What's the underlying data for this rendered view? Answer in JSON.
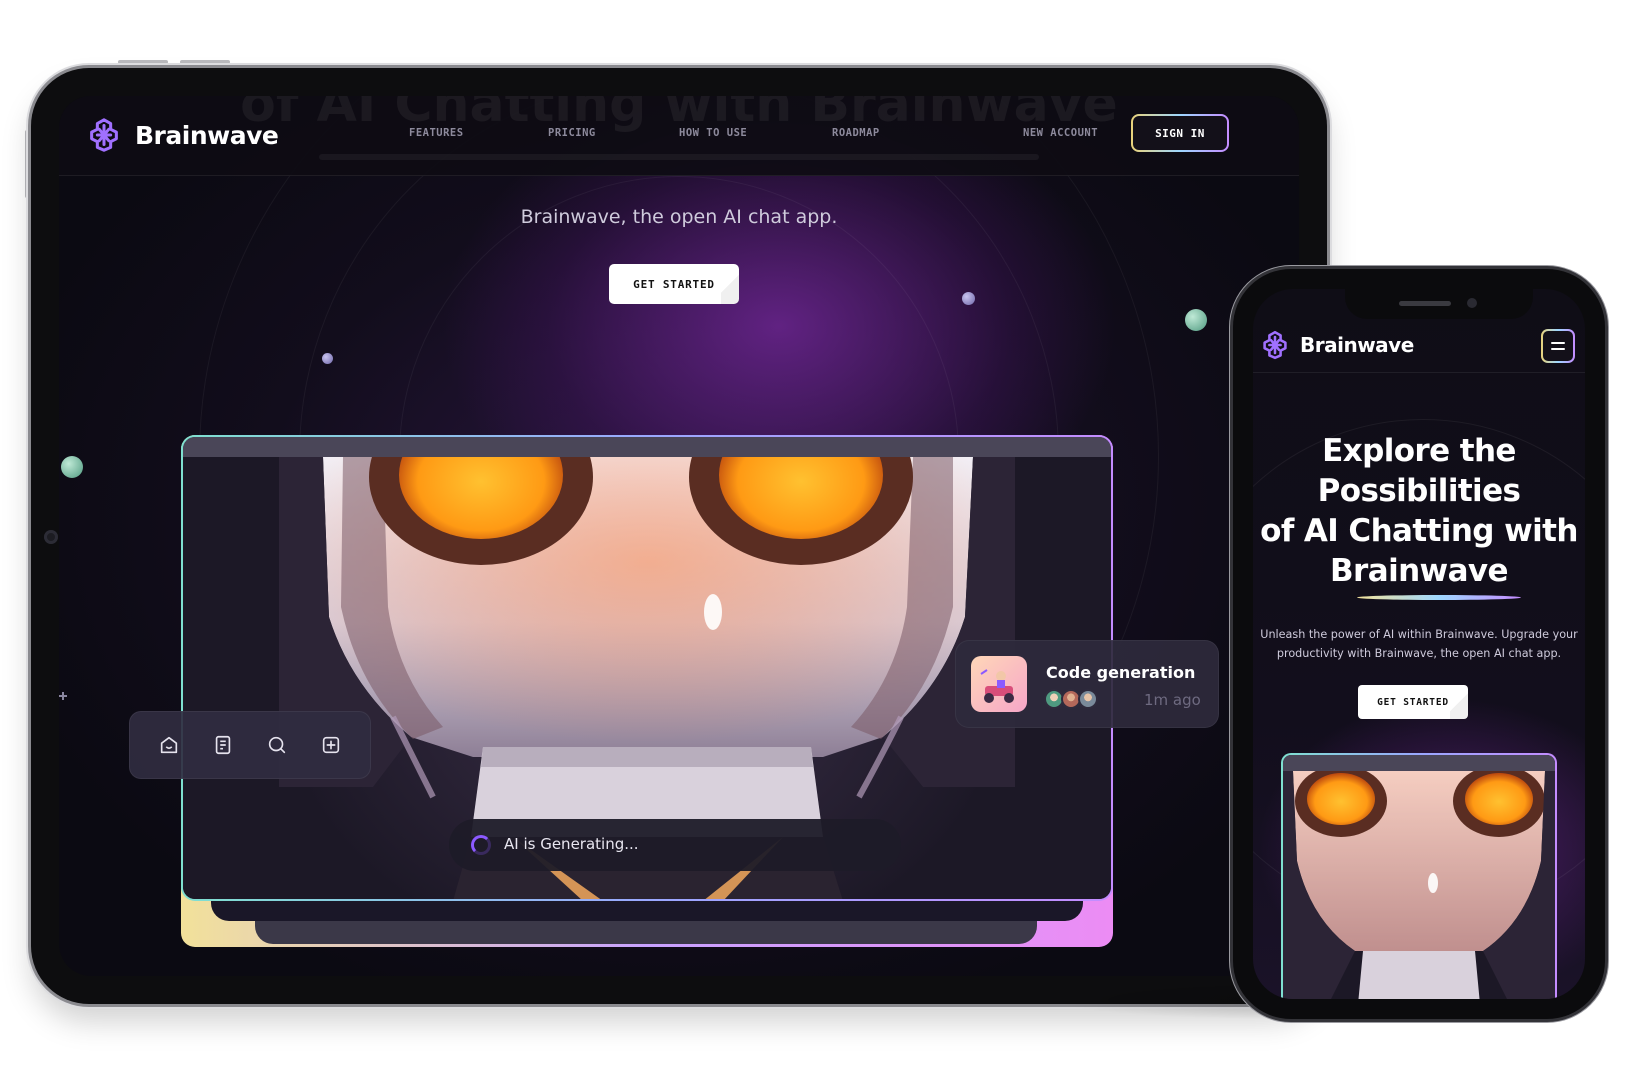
{
  "brand": {
    "name": "Brainwave"
  },
  "tablet": {
    "ghost_title": "of AI Chatting with Brainwave",
    "nav": {
      "links": [
        "FEATURES",
        "PRICING",
        "HOW TO USE",
        "ROADMAP",
        "NEW ACCOUNT"
      ],
      "sign_in": "SIGN IN"
    },
    "hero": {
      "subtitle": "Brainwave, the open AI chat app.",
      "cta": "GET STARTED"
    },
    "card": {
      "title": "Code generation",
      "time": "1m ago"
    },
    "generating": "AI is Generating...",
    "toolbar_icons": [
      "home-icon",
      "document-icon",
      "search-icon",
      "add-square-icon"
    ]
  },
  "phone": {
    "hero": {
      "title_lines": [
        "Explore the",
        "Possibilities",
        "of AI Chatting with",
        "Brainwave"
      ],
      "description_lines": [
        "Unleash the power of AI within Brainwave. Upgrade your",
        "productivity with Brainwave, the open AI chat app."
      ],
      "cta": "GET STARTED"
    }
  },
  "colors": {
    "accent_purple": "#8c5aff",
    "orb_teal": "#5fb89a",
    "gradient_yellow": "#f2e19a",
    "gradient_pink": "#ec8cf4"
  }
}
